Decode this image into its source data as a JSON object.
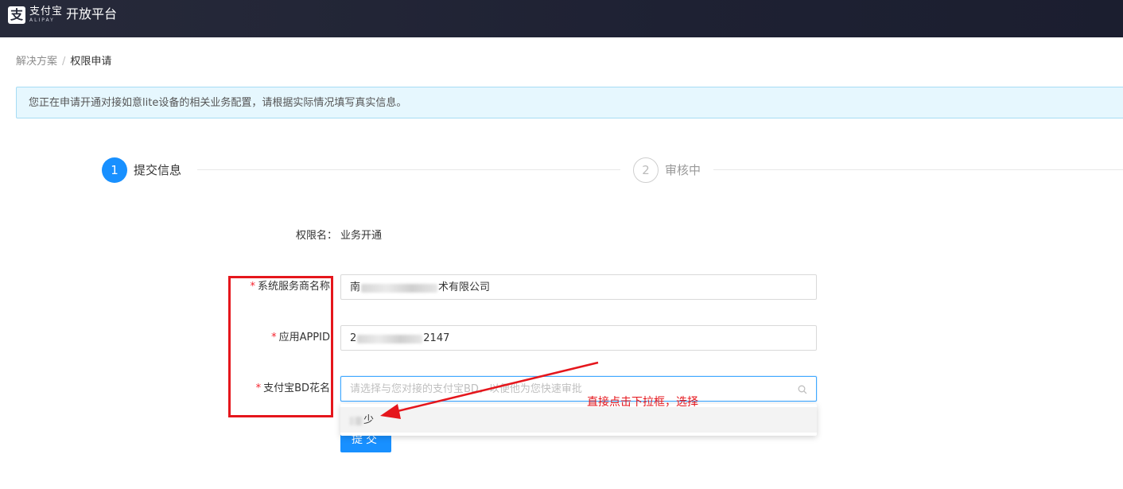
{
  "header": {
    "logo_cn": "支付宝",
    "logo_en": "ALIPAY",
    "logo_mark": "支",
    "title": "开放平台",
    "background_color": "#1e2133"
  },
  "breadcrumb": {
    "items": [
      "解决方案",
      "权限申请"
    ],
    "separator": "/"
  },
  "alert": {
    "text": "您正在申请开通对接如意lite设备的相关业务配置，请根据实际情况填写真实信息。"
  },
  "steps": [
    {
      "number": "1",
      "title": "提交信息",
      "status": "active"
    },
    {
      "number": "2",
      "title": "审核中",
      "status": "wait"
    }
  ],
  "form": {
    "permission_label": "权限名：",
    "permission_value": "业务开通",
    "required_mark": "*",
    "fields": [
      {
        "label": "系统服务商名称",
        "value_suffix": "术有限公司",
        "value_prefix": "南"
      },
      {
        "label": "应用APPID",
        "value_prefix": "2",
        "value_suffix": "2147"
      },
      {
        "label": "支付宝BD花名",
        "placeholder": "请选择与您对接的支付宝BD，以便他为您快速审批"
      }
    ],
    "dropdown_option_suffix": "少",
    "submit_label": "提交"
  },
  "annotation": {
    "text": "直接点击下拉框，选择",
    "color": "#e5161c"
  },
  "colors": {
    "primary": "#1890ff",
    "alert_bg": "#e6f7fe",
    "highlight": "#e5161c"
  }
}
